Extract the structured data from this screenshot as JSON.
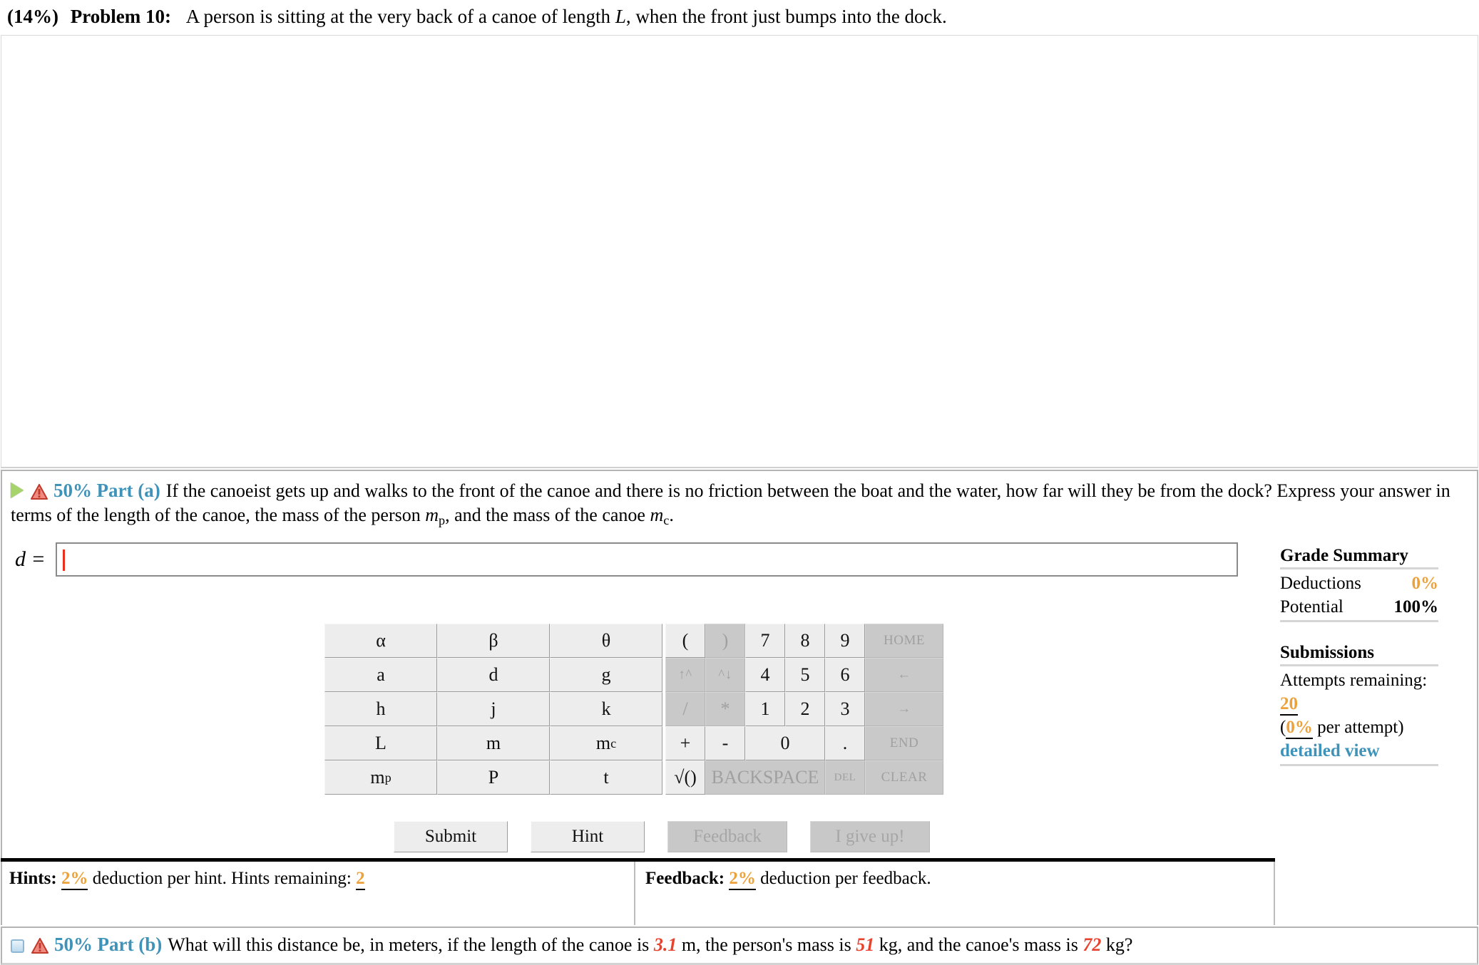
{
  "problem": {
    "percent": "(14%)",
    "title": "Problem 10:",
    "statement_pre": "A person is sitting at the very back of a canoe of length ",
    "statement_var": "L",
    "statement_post": ", when the front just bumps into the dock."
  },
  "part_a": {
    "weight": "50%",
    "label": "Part (a)",
    "text_1": "If the canoeist gets up and walks to the front of the canoe and there is no friction between the boat and the water, how far will they be from the dock? Express your answer in terms of the length of the canoe, the mass of the person ",
    "var_mp": "m",
    "var_mp_sub": "p",
    "text_2": ", and the mass of the canoe ",
    "var_mc": "m",
    "var_mc_sub": "c",
    "text_3": ".",
    "answer_label": "d =",
    "answer_value": "",
    "expand_icon": "play-triangle-icon",
    "warning_icon": "warning-triangle-icon"
  },
  "part_b": {
    "weight": "50%",
    "label": "Part (b)",
    "text_1": "What will this distance be, in meters, if the length of the canoe is ",
    "canoe_length": "3.1",
    "text_2": " m, the person's mass is ",
    "person_mass": "51",
    "text_3": " kg, and the canoe's mass is ",
    "canoe_mass": "72",
    "text_4": " kg?",
    "collapse_icon": "blue-square-icon",
    "warning_icon": "warning-triangle-icon"
  },
  "keypad_vars": [
    [
      {
        "label": "α",
        "disabled": false
      },
      {
        "label": "β",
        "disabled": false
      },
      {
        "label": "θ",
        "disabled": false
      }
    ],
    [
      {
        "label": "a",
        "disabled": false
      },
      {
        "label": "d",
        "disabled": false
      },
      {
        "label": "g",
        "disabled": false
      }
    ],
    [
      {
        "label": "h",
        "disabled": false
      },
      {
        "label": "j",
        "disabled": false
      },
      {
        "label": "k",
        "disabled": false
      }
    ],
    [
      {
        "label": "L",
        "disabled": false
      },
      {
        "label": "m",
        "disabled": false
      },
      {
        "label": "mc",
        "disabled": false
      }
    ],
    [
      {
        "label": "mp",
        "disabled": false
      },
      {
        "label": "P",
        "disabled": false
      },
      {
        "label": "t",
        "disabled": false
      }
    ]
  ],
  "keypad_vars_flat": {
    "r0c0": "α",
    "r0c1": "β",
    "r0c2": "θ",
    "r1c0": "a",
    "r1c1": "d",
    "r1c2": "g",
    "r2c0": "h",
    "r2c1": "j",
    "r2c2": "k",
    "r3c0": "L",
    "r3c1": "m",
    "r3c2base": "m",
    "r3c2sub": "c",
    "r4c0base": "m",
    "r4c0sub": "p",
    "r4c1": "P",
    "r4c2": "t"
  },
  "keypad_num": {
    "open_paren": "(",
    "close_paren": ")",
    "seven": "7",
    "eight": "8",
    "nine": "9",
    "home": "HOME",
    "sup_up": "↑^",
    "sup_down": "^↓",
    "four": "4",
    "five": "5",
    "six": "6",
    "left_arrow": "←",
    "divide": "/",
    "multiply": "*",
    "one": "1",
    "two": "2",
    "three": "3",
    "right_arrow": "→",
    "plus": "+",
    "minus": "-",
    "zero": "0",
    "dot": ".",
    "end": "END",
    "sqrt": "√()",
    "backspace": "BACKSPACE",
    "del": "DEL",
    "clear": "CLEAR"
  },
  "actions": {
    "submit": "Submit",
    "hint": "Hint",
    "feedback": "Feedback",
    "give_up": "I give up!"
  },
  "hints_bar": {
    "hints_label": "Hints:",
    "hints_pct": "2%",
    "hints_text": "deduction per hint. Hints remaining:",
    "hints_remaining": "2",
    "feedback_label": "Feedback:",
    "feedback_pct": "2%",
    "feedback_text": "deduction per feedback."
  },
  "grade_summary": {
    "title": "Grade Summary",
    "deductions_label": "Deductions",
    "deductions_value": "0%",
    "potential_label": "Potential",
    "potential_value": "100%",
    "submissions_title": "Submissions",
    "attempts_label": "Attempts remaining:",
    "attempts_value": "20",
    "per_attempt_open": "(",
    "per_attempt_pct": "0%",
    "per_attempt_text": " per attempt)",
    "detailed_view": "detailed view"
  },
  "colors": {
    "part_label_blue": "#3f92b8",
    "orange": "#eda13a",
    "red_value": "#e8422e",
    "caret_red": "#e8301c",
    "key_bg": "#ededed",
    "key_disabled_bg": "#c9c9c9"
  }
}
